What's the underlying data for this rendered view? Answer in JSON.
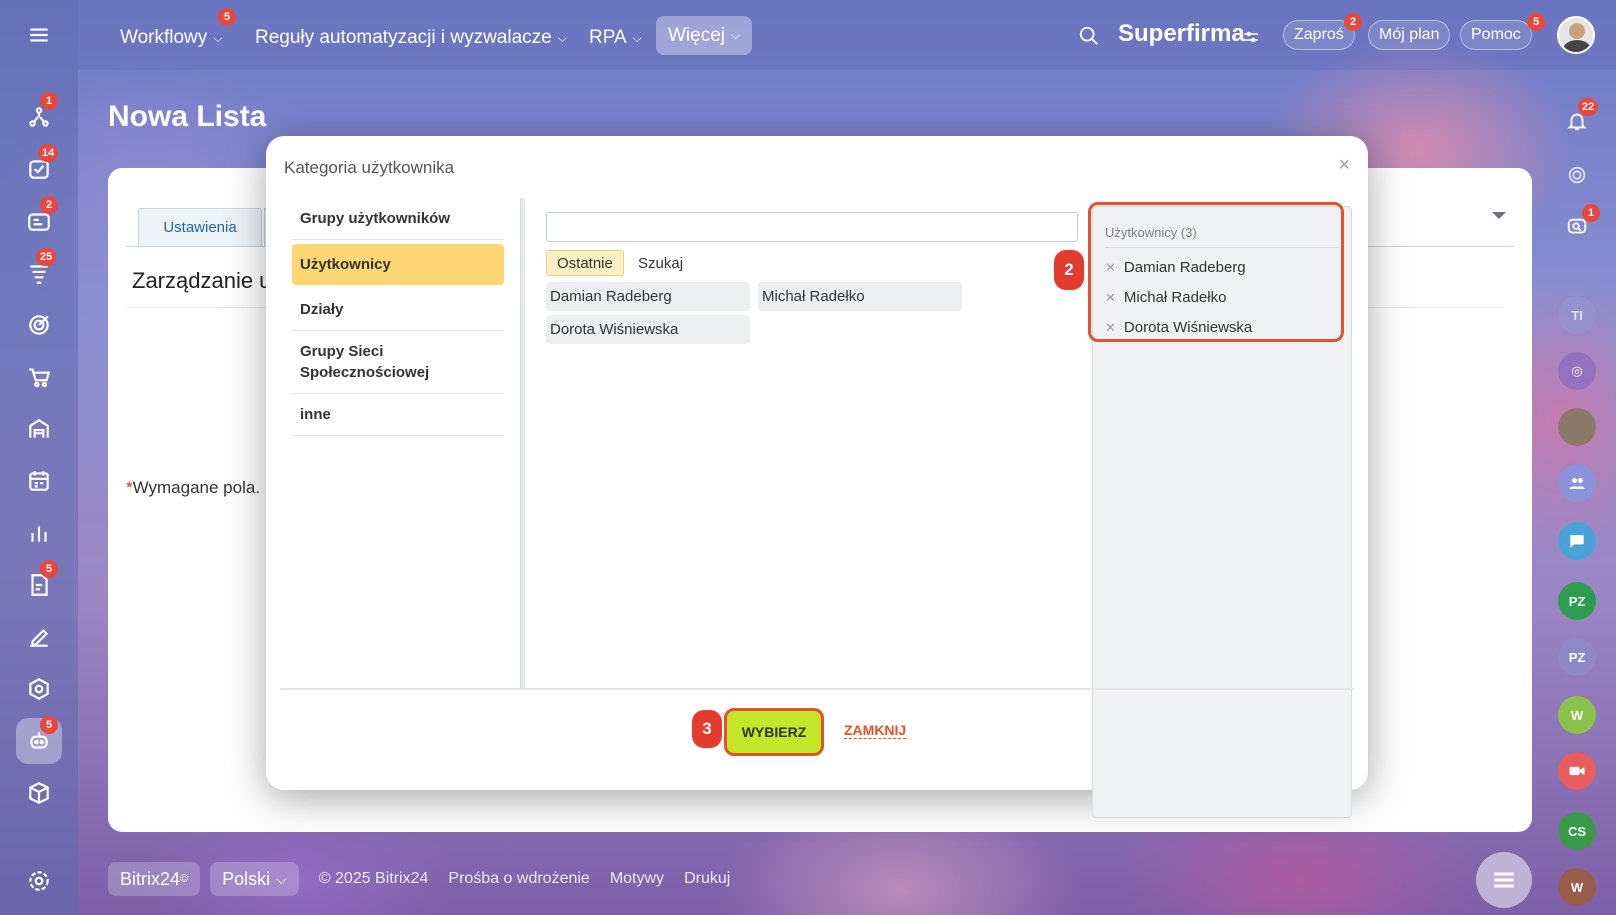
{
  "topnav": {
    "items": [
      {
        "label": "Workflowy",
        "badge": "5"
      },
      {
        "label": "Reguły automatyzacji i wyzwalacze"
      },
      {
        "label": "RPA"
      },
      {
        "label": "Więcej"
      }
    ],
    "company": "Superfirma",
    "invite": {
      "label": "Zaproś",
      "badge": "2"
    },
    "plan": "Mój plan",
    "help": {
      "label": "Pomoc",
      "badge": "5"
    }
  },
  "left_rail_badges": [
    "1",
    "14",
    "2",
    "25",
    "5",
    "5"
  ],
  "right_rail": {
    "bell_badge": "22",
    "chat_badge": "1",
    "avatars": [
      "TI",
      "PZ",
      "PZ",
      "W",
      "CS",
      "W"
    ]
  },
  "page": {
    "title": "Nowa Lista",
    "tab_settings": "Ustawienia",
    "section_title": "Zarządzanie u",
    "required_star": "*",
    "required_text": "Wymagane pola."
  },
  "footer": {
    "brand": "Bitrix24",
    "brand_mark": "©",
    "language": "Polski",
    "copyright": "© 2025 Bitrix24",
    "links": [
      "Prośba o wdrożenie",
      "Motywy",
      "Drukuj"
    ]
  },
  "modal": {
    "title": "Kategoria użytkownika",
    "close_icon": "×",
    "categories": [
      "Grupy użytkowników",
      "Użytkownicy",
      "Działy",
      "Grupy Sieci Społecznościowej",
      "inne"
    ],
    "selected_category": "Użytkownicy",
    "search_placeholder": "",
    "subtabs": [
      "Ostatnie",
      "Szukaj"
    ],
    "users": [
      "Damian Radeberg",
      "Michał Radełko",
      "Dorota Wiśniewska"
    ],
    "selected_header": "Użytkownicy (3)",
    "selected_users": [
      "Damian Radeberg",
      "Michał Radełko",
      "Dorota Wiśniewska"
    ],
    "step_2": "2",
    "step_3": "3",
    "choose_button": "WYBIERZ",
    "close_button": "ZAMKNIJ"
  },
  "colors": {
    "accent_orange": "#e0532c",
    "badge_red": "#e8473d",
    "choose_green": "#c6e62a",
    "selected_yellow": "#fcd773"
  }
}
